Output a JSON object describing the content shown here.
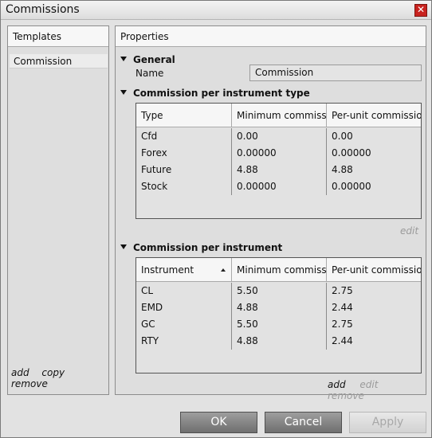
{
  "window": {
    "title": "Commissions"
  },
  "templates": {
    "header": "Templates",
    "items": [
      "Commission"
    ],
    "actions": {
      "add": "add",
      "copy": "copy",
      "remove": "remove"
    }
  },
  "properties": {
    "header": "Properties",
    "general": {
      "label": "General",
      "name_label": "Name",
      "name_value": "Commission"
    },
    "per_type": {
      "label": "Commission per instrument type",
      "columns": [
        "Type",
        "Minimum commissi",
        "Per-unit commissio"
      ],
      "rows": [
        [
          "Cfd",
          "0.00",
          "0.00"
        ],
        [
          "Forex",
          "0.00000",
          "0.00000"
        ],
        [
          "Future",
          "4.88",
          "4.88"
        ],
        [
          "Stock",
          "0.00000",
          "0.00000"
        ]
      ],
      "edit": "edit"
    },
    "per_instrument": {
      "label": "Commission per instrument",
      "columns": [
        "Instrument",
        "Minimum commissi",
        "Per-unit commissio"
      ],
      "rows": [
        [
          "CL",
          "5.50",
          "2.75"
        ],
        [
          "EMD",
          "4.88",
          "2.44"
        ],
        [
          "GC",
          "5.50",
          "2.75"
        ],
        [
          "RTY",
          "4.88",
          "2.44"
        ]
      ],
      "actions": {
        "add": "add",
        "edit": "edit",
        "remove": "remove"
      }
    }
  },
  "buttons": {
    "ok": "OK",
    "cancel": "Cancel",
    "apply": "Apply"
  }
}
